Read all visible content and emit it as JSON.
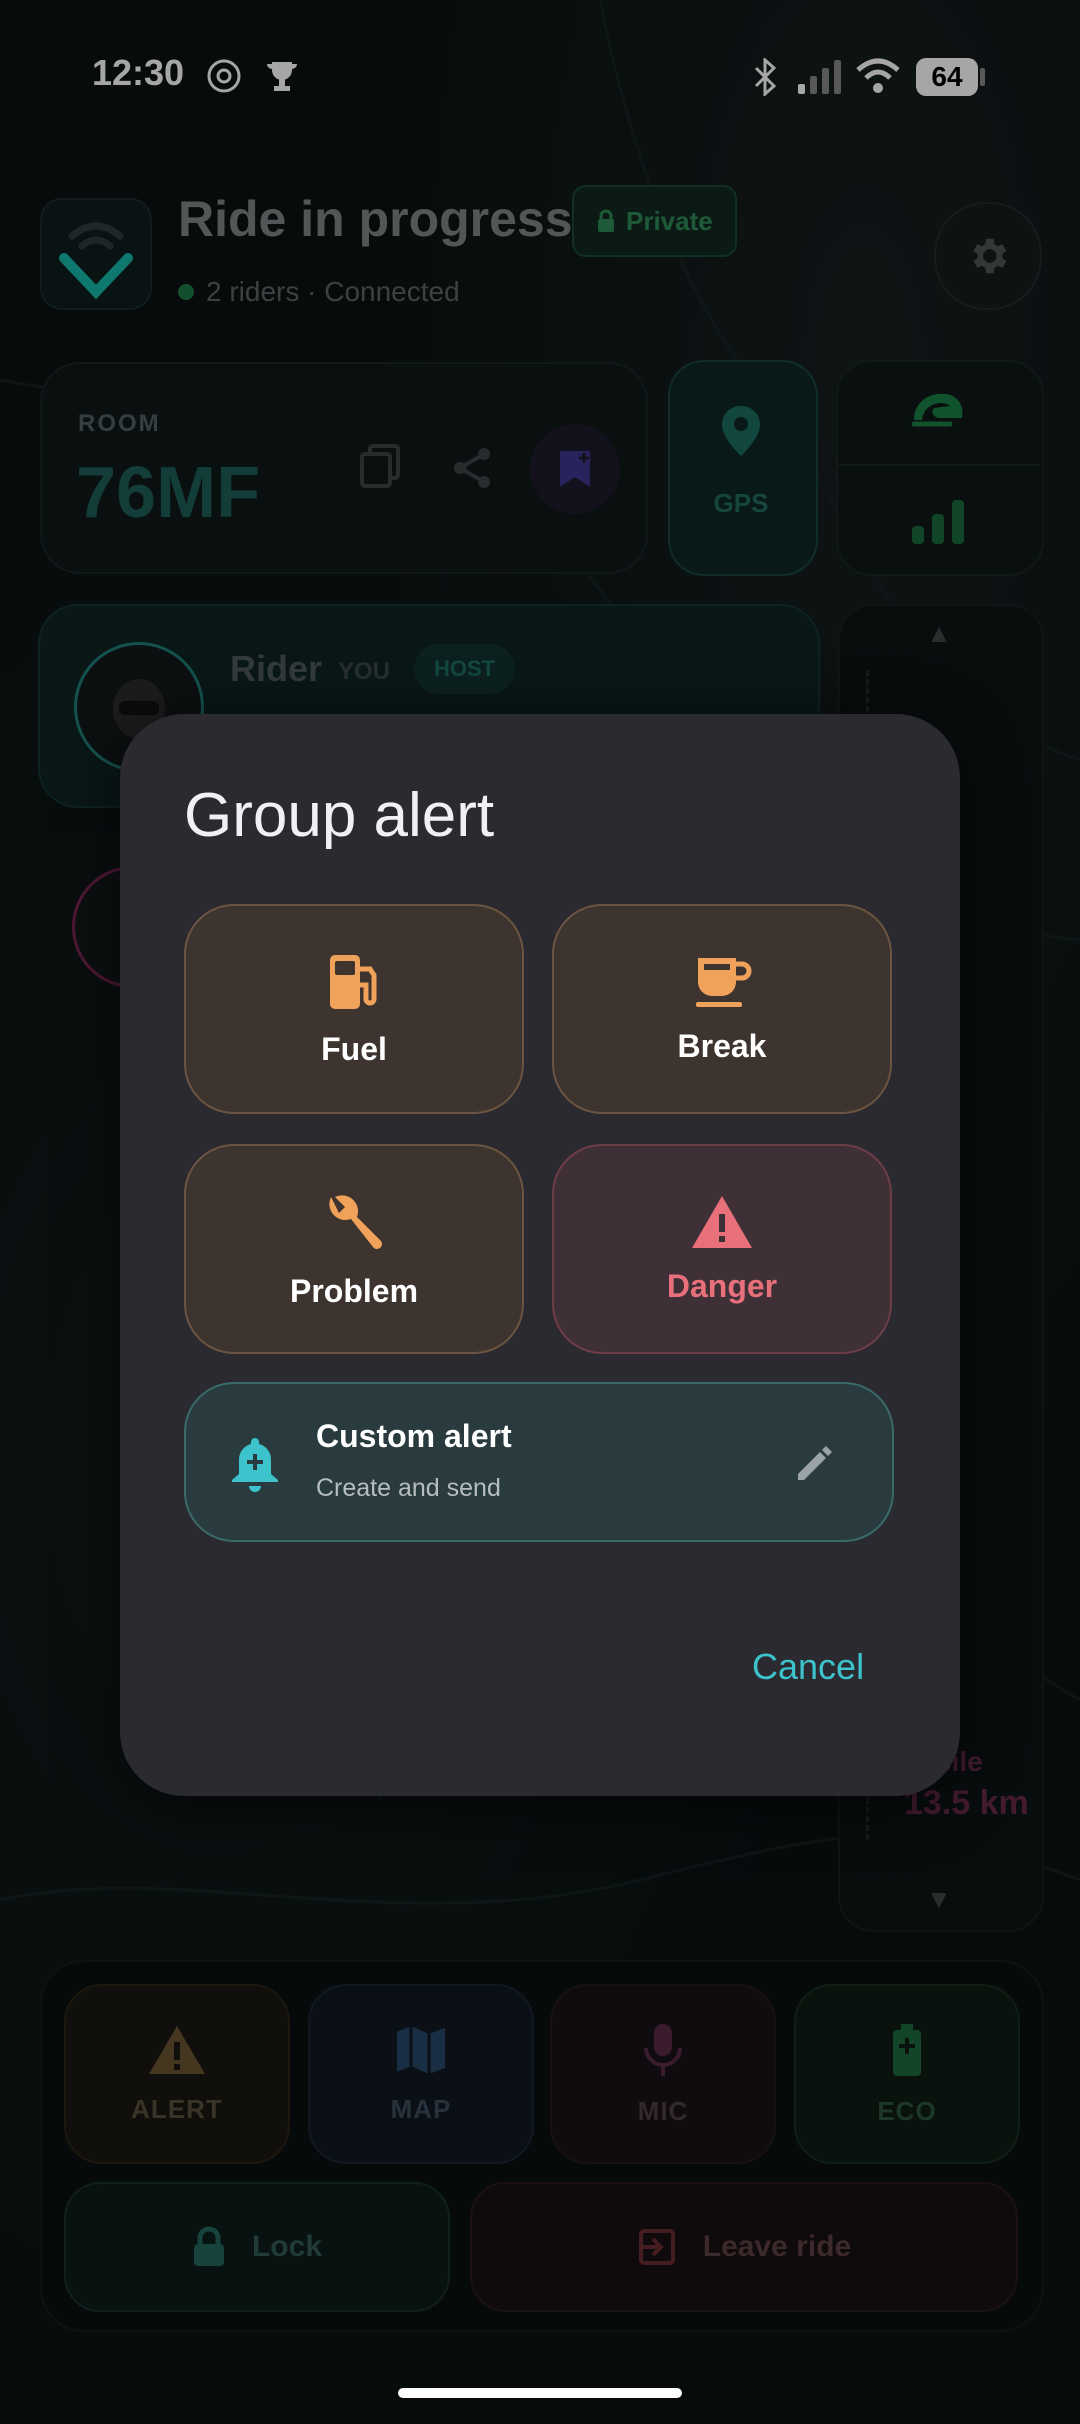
{
  "status_bar": {
    "time": "12:30",
    "battery": "64"
  },
  "header": {
    "title": "Ride in progress",
    "privacy": "Private",
    "subtitle": "2 riders · Connected"
  },
  "room": {
    "label": "ROOM",
    "code": "76MF"
  },
  "gps": {
    "label": "GPS"
  },
  "riders": [
    {
      "name": "Rider",
      "you": "YOU",
      "role": "HOST"
    }
  ],
  "side_panel": {
    "distance_label": "cile",
    "distance_value": "13.5 km"
  },
  "controls": {
    "alert": "ALERT",
    "map": "MAP",
    "mic": "MIC",
    "eco": "ECO",
    "lock": "Lock",
    "leave": "Leave ride"
  },
  "dialog": {
    "title": "Group alert",
    "options": {
      "fuel": "Fuel",
      "break": "Break",
      "problem": "Problem",
      "danger": "Danger"
    },
    "custom_title": "Custom alert",
    "custom_subtitle": "Create and send",
    "cancel": "Cancel"
  },
  "colors": {
    "accent": "#3cc3cc",
    "warning_orange": "#f0a15a",
    "danger_red": "#e8707a",
    "dialog_bg": "#2a2a30"
  }
}
